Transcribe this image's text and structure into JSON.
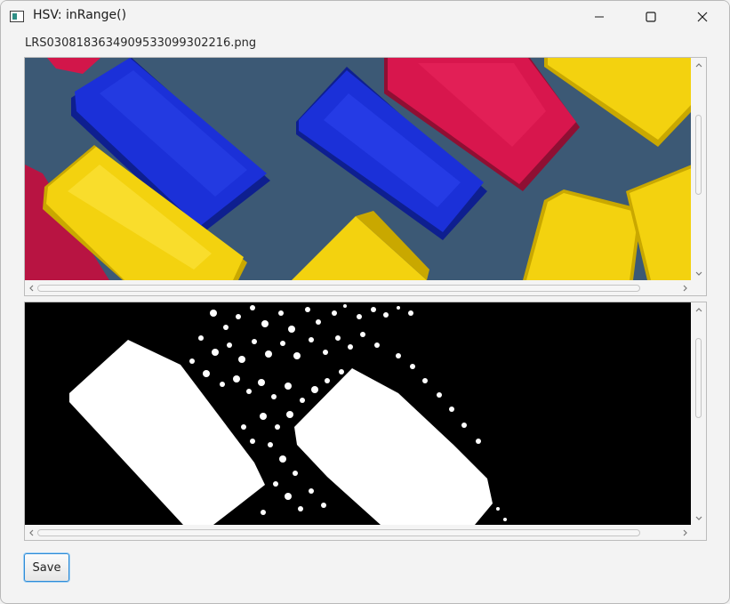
{
  "window": {
    "title": "HSV: inRange()",
    "controls": {
      "minimize_icon": "minimize-icon",
      "maximize_icon": "maximize-icon",
      "close_icon": "close-icon"
    }
  },
  "filename": "LRS030818363490953309930​2216.png",
  "panes": {
    "original": {
      "description_icon": "image-view"
    },
    "mask": {
      "description_icon": "image-view"
    }
  },
  "actions": {
    "save_label": "Save"
  },
  "colors": {
    "background": "#f3f3f3",
    "accent_border": "#2e8bd6",
    "mask_background": "#000000",
    "mask_foreground": "#ffffff",
    "photo_background": "#3f5d79",
    "block_blue": "#1a2fd6",
    "block_red": "#d8164d",
    "block_yellow": "#f3d20f"
  }
}
